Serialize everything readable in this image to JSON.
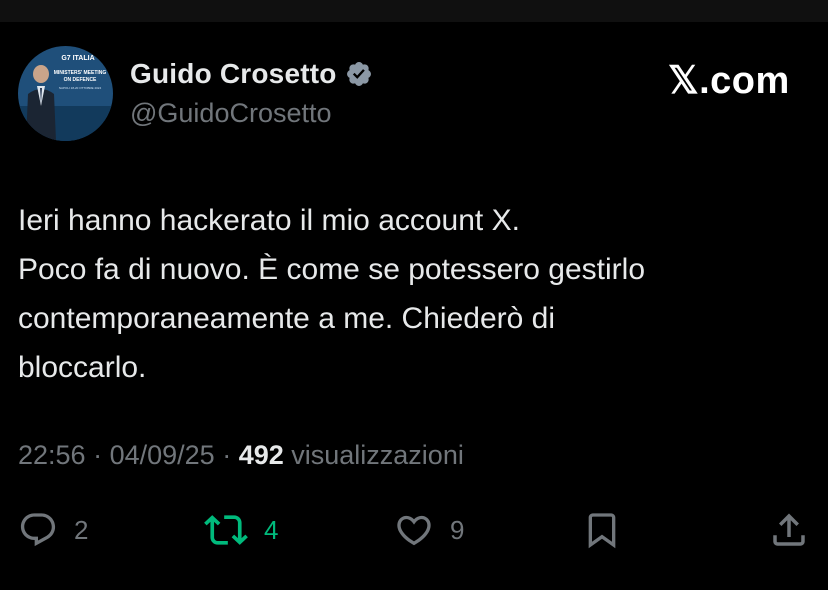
{
  "author": {
    "display_name": "Guido Crosetto",
    "handle": "@GuidoCrosetto",
    "verified": true,
    "verified_color": "#8b98a5"
  },
  "brand": {
    "label": "𝕏.com"
  },
  "avatar": {
    "banner_lines": [
      "G7 ITALIA",
      "MINISTERS' MEETING",
      "ON DEFENCE",
      "NAPOLI 18-20 OTTOBRE 2024"
    ]
  },
  "tweet": {
    "lines": [
      "Ieri hanno hackerato il mio account X.",
      "Poco fa di nuovo. È come se potessero gestirlo",
      "contemporaneamente a me. Chiederò di",
      "bloccarlo."
    ]
  },
  "meta": {
    "time": "22:56",
    "separator": " · ",
    "date": "04/09/25",
    "views_count": "492",
    "views_label": "visualizzazioni"
  },
  "actions": {
    "replies": "2",
    "reposts": "4",
    "likes": "9",
    "repost_color": "#00ba7c",
    "icon_color": "#71767b"
  }
}
